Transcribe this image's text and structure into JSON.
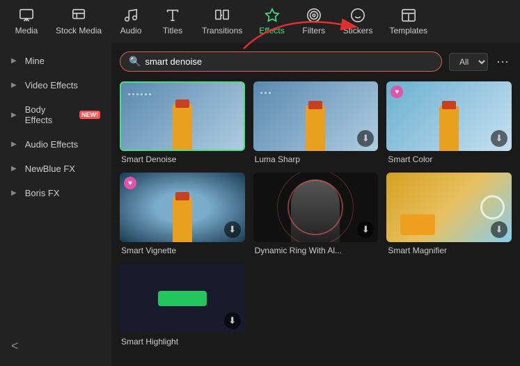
{
  "nav": {
    "items": [
      {
        "id": "media",
        "label": "Media",
        "icon": "media"
      },
      {
        "id": "stock-media",
        "label": "Stock Media",
        "icon": "stock"
      },
      {
        "id": "audio",
        "label": "Audio",
        "icon": "audio"
      },
      {
        "id": "titles",
        "label": "Titles",
        "icon": "titles"
      },
      {
        "id": "transitions",
        "label": "Transitions",
        "icon": "transitions"
      },
      {
        "id": "effects",
        "label": "Effects",
        "icon": "effects",
        "active": true
      },
      {
        "id": "filters",
        "label": "Filters",
        "icon": "filters"
      },
      {
        "id": "stickers",
        "label": "Stickers",
        "icon": "stickers"
      },
      {
        "id": "templates",
        "label": "Templates",
        "icon": "templates"
      }
    ]
  },
  "sidebar": {
    "items": [
      {
        "id": "mine",
        "label": "Mine"
      },
      {
        "id": "video-effects",
        "label": "Video Effects"
      },
      {
        "id": "body-effects",
        "label": "Body Effects",
        "badge": "NEW!"
      },
      {
        "id": "audio-effects",
        "label": "Audio Effects"
      },
      {
        "id": "newblue-fx",
        "label": "NewBlue FX"
      },
      {
        "id": "boris-fx",
        "label": "Boris FX"
      }
    ],
    "collapse_icon": "<"
  },
  "search": {
    "value": "smart denoise",
    "placeholder": "smart denoise"
  },
  "filter": {
    "label": "All",
    "more_icon": "···"
  },
  "effects": [
    {
      "id": "smart-denoise",
      "label": "Smart Denoise",
      "selected": true,
      "has_badge": false,
      "has_download": false,
      "thumb_type": "lighthouse"
    },
    {
      "id": "luma-sharp",
      "label": "Luma Sharp",
      "selected": false,
      "has_badge": false,
      "has_download": true,
      "thumb_type": "luma"
    },
    {
      "id": "smart-color",
      "label": "Smart Color",
      "selected": false,
      "has_badge": true,
      "has_download": true,
      "thumb_type": "color"
    },
    {
      "id": "smart-vignette",
      "label": "Smart Vignette",
      "selected": false,
      "has_badge": true,
      "has_download": true,
      "thumb_type": "vignette"
    },
    {
      "id": "dynamic-ring",
      "label": "Dynamic Ring With Al...",
      "selected": false,
      "has_badge": false,
      "has_download": true,
      "thumb_type": "dynamic"
    },
    {
      "id": "smart-magnifier",
      "label": "Smart Magnifier",
      "selected": false,
      "has_badge": false,
      "has_download": true,
      "thumb_type": "magnifier"
    },
    {
      "id": "smart-highlight",
      "label": "Smart Highlight",
      "selected": false,
      "has_badge": false,
      "has_download": true,
      "thumb_type": "highlight"
    }
  ]
}
